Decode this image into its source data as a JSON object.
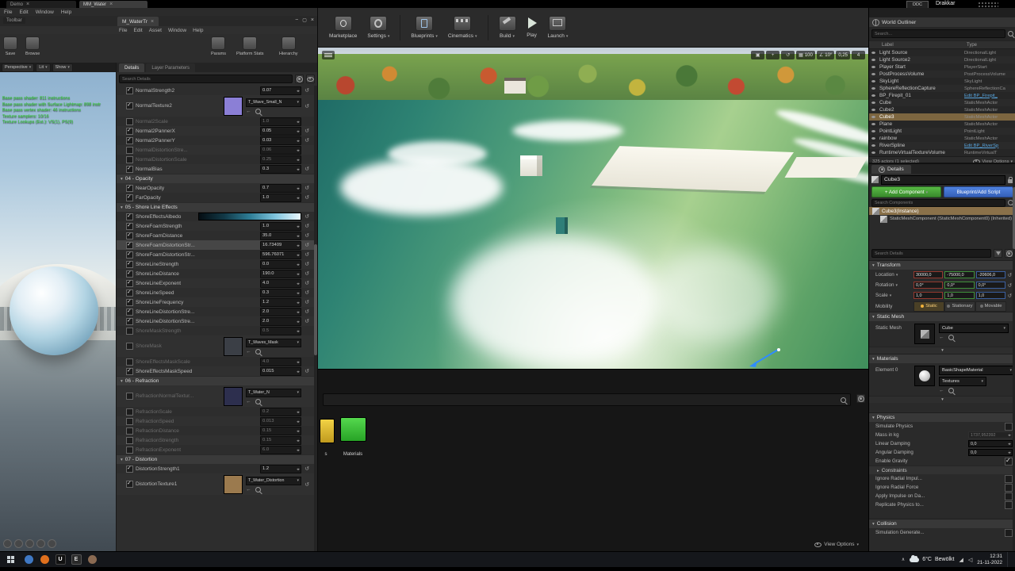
{
  "top": {
    "tab_demo": "Demo",
    "tab_mm_water": "MM_Water",
    "ddc": "DDC",
    "drakkar": "Drakkar"
  },
  "mat_editor": {
    "menu": {
      "file": "File",
      "edit": "Edit",
      "window": "Window",
      "help": "Help"
    },
    "toolbar_label": "Toolbar",
    "asset_tab": "M_WaterTr",
    "inner_menu": {
      "file": "File",
      "edit": "Edit",
      "asset": "Asset",
      "window": "Window",
      "help": "Help"
    },
    "toolbar": {
      "save": "Save",
      "browse": "Browse",
      "params": "Params",
      "platform_stats": "Platform Stats",
      "hierarchy": "Hierarchy"
    },
    "preview": {
      "perspective": "Perspective",
      "lit": "Lit",
      "show": "Show",
      "stats": [
        "Base pass shader: 811 instructions",
        "Base pass shader with Surface Lightmap: 898 instr",
        "Base pass vertex shader: 46 instructions",
        "Texture samplers: 10/16",
        "Texture Lookups (Est.): VS(1), PS(9)"
      ]
    },
    "tabs": {
      "details": "Details",
      "layer_parameters": "Layer Parameters"
    },
    "search_placeholder": "Search Details",
    "params": [
      {
        "label": "NormalStrength2",
        "value": "0.07"
      },
      {
        "label": "NormalTexture2",
        "tex": true,
        "texname": "T_Wave_Small_N",
        "thumb": "#8b7fd6"
      },
      {
        "label": "Normal2Scale",
        "value": "1.0",
        "muted": true
      },
      {
        "label": "Normal2PannerX",
        "value": "0.05"
      },
      {
        "label": "Normal2PannerY",
        "value": "0.03"
      },
      {
        "label": "NormalDistortionStre...",
        "value": "0.06",
        "muted": true
      },
      {
        "label": "NormalDistortionScale",
        "value": "0.25",
        "muted": true
      },
      {
        "label": "NormalBias",
        "value": "0.3"
      },
      {
        "header": "04 - Opacity"
      },
      {
        "label": "NearOpacity",
        "value": "0.7"
      },
      {
        "label": "FarOpacity",
        "value": "1.0"
      },
      {
        "header": "05 - Shore Line Effects"
      },
      {
        "label": "ShoreEffectsAlbedo",
        "color": true
      },
      {
        "label": "ShoreFoamStrength",
        "value": "1.0"
      },
      {
        "label": "ShoreFoamDistance",
        "value": "35.0"
      },
      {
        "label": "ShoreFoamDistortionStr...",
        "value": "16.73409",
        "hilite": true
      },
      {
        "label": "ShoreFoamDistortionStr...",
        "value": "596.76071"
      },
      {
        "label": "ShoreLineStrength",
        "value": "0.0"
      },
      {
        "label": "ShoreLineDistance",
        "value": "190.0"
      },
      {
        "label": "ShoreLineExponent",
        "value": "4.0"
      },
      {
        "label": "ShoreLineSpeed",
        "value": "0.3"
      },
      {
        "label": "ShoreLineFrequency",
        "value": "1.2"
      },
      {
        "label": "ShoreLineDistortionStre...",
        "value": "2.0"
      },
      {
        "label": "ShoreLineDistortionStre...",
        "value": "2.0"
      },
      {
        "label": "ShoreMaskStrength",
        "value": "0.5",
        "muted": true
      },
      {
        "label": "ShoreMask",
        "tex": true,
        "texname": "T_Waves_Mask",
        "thumb": "#3b3f46",
        "muted": true
      },
      {
        "label": "ShoreEffectsMaskScale",
        "value": "4.0",
        "muted": true
      },
      {
        "label": "ShoreEffectsMaskSpeed",
        "value": "0.015"
      },
      {
        "header": "06 - Refraction"
      },
      {
        "label": "RefractionNormalTextur...",
        "tex": true,
        "texname": "T_Water_N",
        "thumb": "#2d2f4e",
        "muted": true
      },
      {
        "label": "RefractionScale",
        "value": "0.2",
        "muted": true
      },
      {
        "label": "RefractionSpeed",
        "value": "0.013",
        "muted": true
      },
      {
        "label": "RefractionDistance",
        "value": "0.15",
        "muted": true
      },
      {
        "label": "RefractionStrength",
        "value": "0.15",
        "muted": true
      },
      {
        "label": "RefractionExponent",
        "value": "6.0",
        "muted": true
      },
      {
        "header": "07 - Distortion"
      },
      {
        "label": "DistortionStrength1",
        "value": "1.2"
      },
      {
        "label": "DistortionTexture1",
        "tex": true,
        "texname": "T_Water_Distortion",
        "thumb": "#9b7a4e"
      }
    ]
  },
  "main_toolbar": {
    "marketplace": "Marketplace",
    "settings": "Settings",
    "blueprints": "Blueprints",
    "cinematics": "Cinematics",
    "build": "Build",
    "play": "Play",
    "launch": "Launch"
  },
  "viewport_hud": {
    "grid_snap": "100",
    "rotation_snap": "10°",
    "scale_snap": "0,25",
    "camera_speed": "4"
  },
  "content_browser": {
    "clipped_label": "s",
    "materials_label": "Materials",
    "view_options": "View Options"
  },
  "outliner": {
    "title": "World Outliner",
    "search_placeholder": "Search...",
    "columns": {
      "label": "Label",
      "type": "Type"
    },
    "rows": [
      {
        "label": "Light Source",
        "type": "DirectionalLight"
      },
      {
        "label": "Light Source2",
        "type": "DirectionalLight"
      },
      {
        "label": "Player Start",
        "type": "PlayerStart"
      },
      {
        "label": "PostProcessVolume",
        "type": "PostProcessVolume"
      },
      {
        "label": "SkyLight",
        "type": "SkyLight"
      },
      {
        "label": "SphereReflectionCapture",
        "type": "SphereReflectionCa"
      },
      {
        "label": "BP_Firepit_01",
        "type": "Edit BP_Firepit_",
        "link": true
      },
      {
        "label": "Cube",
        "type": "StaticMeshActor"
      },
      {
        "label": "Cube2",
        "type": "StaticMeshActor"
      },
      {
        "label": "Cube3",
        "type": "StaticMeshActor",
        "selected": true
      },
      {
        "label": "Plane",
        "type": "StaticMeshActor"
      },
      {
        "label": "PointLight",
        "type": "PointLight"
      },
      {
        "label": "rainbow",
        "type": "StaticMeshActor"
      },
      {
        "label": "RiverSpline",
        "type": "Edit BP_RiverSp",
        "link": true
      },
      {
        "label": "RuntimeVirtualTextureVolume",
        "type": "RuntimeVirtualT"
      }
    ],
    "footer": "325 actors (1 selected)",
    "view_options": "View Options"
  },
  "details": {
    "tab": "Details",
    "name_value": "Cube3",
    "add_component": "+ Add Component",
    "blueprint_add_script": "Blueprint/Add Script",
    "search_components_placeholder": "Search Components",
    "instance": "Cube3(Instance)",
    "component": "StaticMeshComponent (StaticMeshComponent0) (Inherited)",
    "search_details_placeholder": "Search Details",
    "transform": {
      "title": "Transform",
      "rows": [
        {
          "label": "Location",
          "x": "30000,0",
          "y": "-75000,0",
          "z": "-20606,0"
        },
        {
          "label": "Rotation",
          "x": "0,0°",
          "y": "0,0°",
          "z": "0,0°"
        },
        {
          "label": "Scale",
          "x": "1,0",
          "y": "1,0",
          "z": "1,0"
        }
      ],
      "mobility_label": "Mobility",
      "mobility": [
        {
          "label": "Static",
          "active": true
        },
        {
          "label": "Stationary"
        },
        {
          "label": "Movable"
        }
      ]
    },
    "static_mesh": {
      "title": "Static Mesh",
      "label": "Static Mesh",
      "value": "Cube"
    },
    "materials": {
      "title": "Materials",
      "element": "Element 0",
      "value": "BasicShapeMaterial",
      "textures": "Textures"
    },
    "physics": {
      "title": "Physics",
      "rows": [
        {
          "label": "Simulate Physics",
          "is_check": true
        },
        {
          "label": "Mass in kg",
          "value": "1737,952392",
          "muted": true
        },
        {
          "label": "Linear Damping",
          "value": "0,0"
        },
        {
          "label": "Angular Damping",
          "value": "0,0"
        },
        {
          "label": "Enable Gravity",
          "is_check": true,
          "checked": true
        }
      ],
      "constraints": "Constraints",
      "flags": [
        {
          "label": "Ignore Radial Impul..."
        },
        {
          "label": "Ignore Radial Force"
        },
        {
          "label": "Apply Impulse on Da..."
        },
        {
          "label": "Replicate Physics to..."
        }
      ]
    },
    "collision": {
      "title": "Collision",
      "row": "Simulation Generate..."
    }
  },
  "taskbar": {
    "weather_temp": "6°C",
    "weather_cond": "Bewölkt",
    "time": "12:31",
    "date": "21-11-2022"
  }
}
